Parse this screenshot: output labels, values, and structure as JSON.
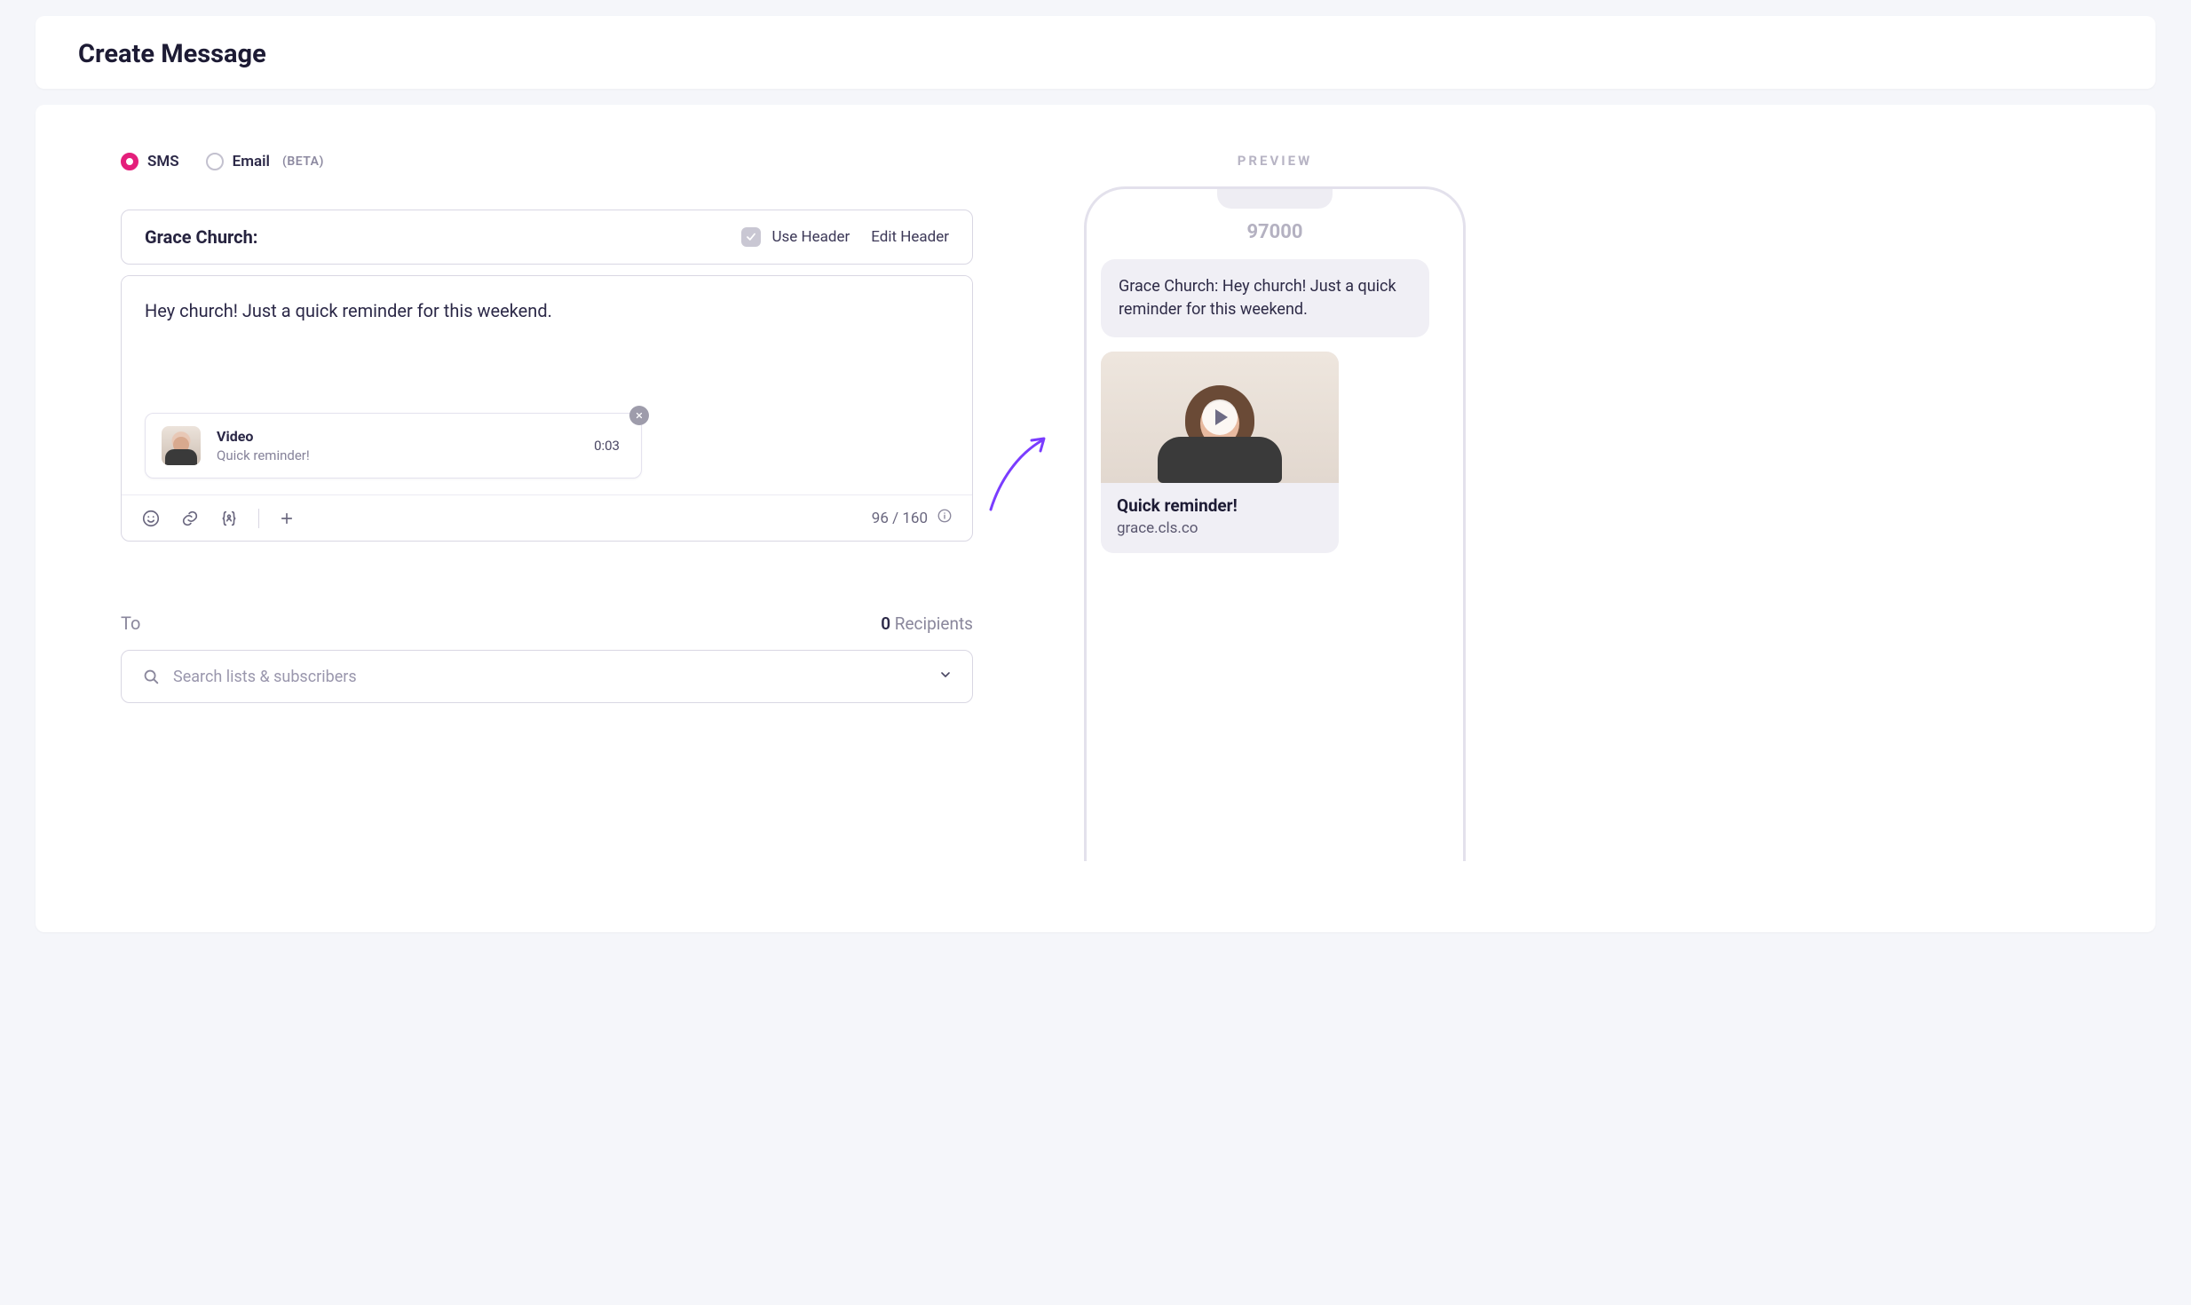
{
  "page": {
    "title": "Create Message"
  },
  "channels": {
    "sms": {
      "label": "SMS",
      "selected": true
    },
    "email": {
      "label": "Email",
      "beta": "(BETA)",
      "selected": false
    }
  },
  "header": {
    "name": "Grace Church:",
    "use_header_label": "Use Header",
    "use_header_checked": true,
    "edit_header_label": "Edit Header"
  },
  "composer": {
    "text": "Hey church! Just a quick reminder for this weekend.",
    "attachment": {
      "type_label": "Video",
      "caption": "Quick reminder!",
      "duration": "0:03"
    },
    "counter": "96 / 160"
  },
  "to": {
    "label": "To",
    "recipients_count": "0",
    "recipients_label": "Recipients",
    "placeholder": "Search lists & subscribers"
  },
  "preview": {
    "label": "PREVIEW",
    "number": "97000",
    "bubble_text": "Grace Church: Hey church! Just a quick reminder for this weekend.",
    "card_title": "Quick reminder!",
    "card_link": "grace.cls.co"
  }
}
